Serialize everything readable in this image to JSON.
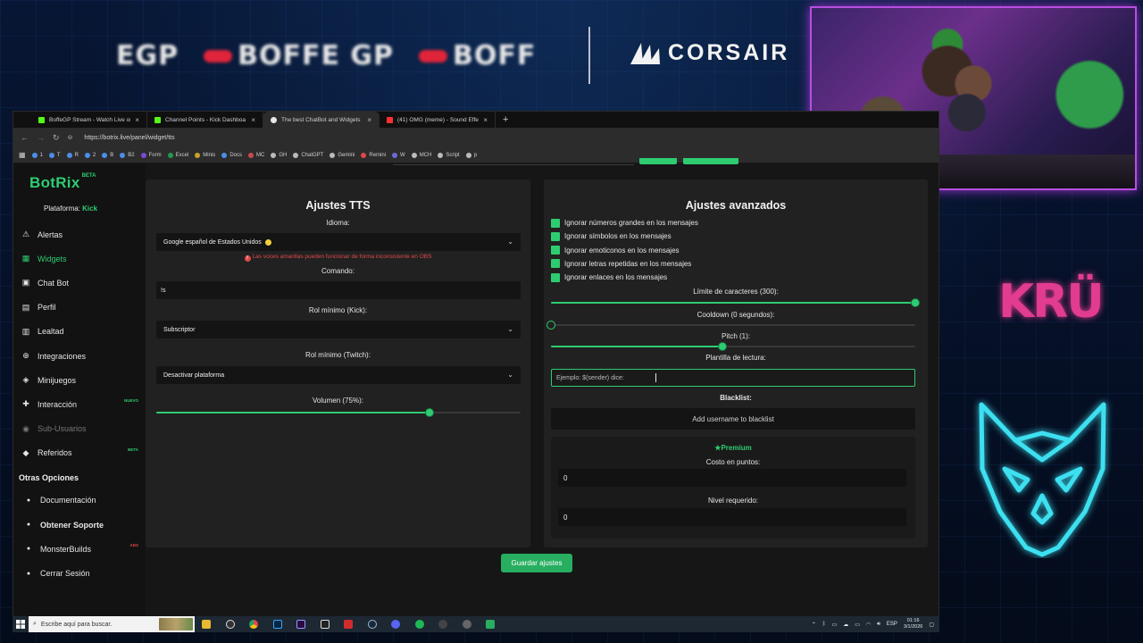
{
  "overlay": {
    "ticker": [
      "EGP",
      "BOFFE GP",
      "BOFF"
    ],
    "sponsor": "CORSAIR",
    "right_logo": "KRÜ"
  },
  "browser": {
    "tabs": [
      {
        "label": "BoffeGP Stream - Watch Live on",
        "color": "#53fc18"
      },
      {
        "label": "Channel Points - Kick Dashboa",
        "color": "#53fc18"
      },
      {
        "label": "The best ChatBot and Widgets",
        "color": "#e8e8e8"
      },
      {
        "label": "(41) OMG (meme) - Sound Effe",
        "color": "#ff3030"
      }
    ],
    "new_tab": "+",
    "url": "https://botrix.live/panel/widget/tts",
    "bookmarks": [
      {
        "label": "1",
        "color": "#4a8fe7"
      },
      {
        "label": "T",
        "color": "#4a8fe7"
      },
      {
        "label": "R",
        "color": "#4a8fe7"
      },
      {
        "label": "2",
        "color": "#4a8fe7"
      },
      {
        "label": "B",
        "color": "#4a8fe7"
      },
      {
        "label": "B2",
        "color": "#4a8fe7"
      },
      {
        "label": "Form",
        "color": "#7b4ad6"
      },
      {
        "label": "Excel",
        "color": "#1f9b4a"
      },
      {
        "label": "Minis",
        "color": "#c9a227"
      },
      {
        "label": "Docs",
        "color": "#4a8fe7"
      },
      {
        "label": "MC",
        "color": "#c94a4a"
      },
      {
        "label": "GH",
        "color": "#bbbbbb"
      },
      {
        "label": "ChatGPT",
        "color": "#bbbbbb"
      },
      {
        "label": "Gemini",
        "color": "#bbbbbb"
      },
      {
        "label": "Remini",
        "color": "#e04848"
      },
      {
        "label": "W",
        "color": "#6a6ad6"
      },
      {
        "label": "MCH",
        "color": "#bbbbbb"
      },
      {
        "label": "Script",
        "color": "#bbbbbb"
      },
      {
        "label": "p",
        "color": "#bbbbbb"
      }
    ]
  },
  "app": {
    "logo": "BotRix",
    "beta": "BETA",
    "platform_label": "Plataforma:",
    "platform_value": "Kick",
    "nav": [
      {
        "label": "Alertas",
        "icon": "⚠",
        "active": false,
        "disabled": false,
        "badge": ""
      },
      {
        "label": "Widgets",
        "icon": "▦",
        "active": true,
        "disabled": false,
        "badge": ""
      },
      {
        "label": "Chat Bot",
        "icon": "▣",
        "active": false,
        "disabled": false,
        "badge": ""
      },
      {
        "label": "Perfil",
        "icon": "▤",
        "active": false,
        "disabled": false,
        "badge": ""
      },
      {
        "label": "Lealtad",
        "icon": "▥",
        "active": false,
        "disabled": false,
        "badge": ""
      },
      {
        "label": "Integraciones",
        "icon": "⊕",
        "active": false,
        "disabled": false,
        "badge": ""
      },
      {
        "label": "Minijuegos",
        "icon": "◈",
        "active": false,
        "disabled": false,
        "badge": ""
      },
      {
        "label": "Interacción",
        "icon": "✚",
        "active": false,
        "disabled": false,
        "badge": "NUEVO"
      },
      {
        "label": "Sub-Usuarios",
        "icon": "◉",
        "active": false,
        "disabled": true,
        "badge": ""
      },
      {
        "label": "Referidos",
        "icon": "◆",
        "active": false,
        "disabled": false,
        "badge": "BETA"
      }
    ],
    "other_options_title": "Otras Opciones",
    "other_options": [
      {
        "label": "Documentación",
        "icon": "●",
        "badge": ""
      },
      {
        "label": "Obtener Soporte",
        "icon": "●",
        "badge": ""
      },
      {
        "label": "MonsterBuilds",
        "icon": "●",
        "badge": "ADS"
      },
      {
        "label": "Cerrar Sesión",
        "icon": "●",
        "badge": ""
      }
    ]
  },
  "tts": {
    "title": "Ajustes TTS",
    "idioma_label": "Idioma:",
    "idioma_value": "Google español de Estados Unidos",
    "warning": "Las voces amarillas pueden funcionar de forma inconsistente en OBS",
    "comando_label": "Comando:",
    "comando_value": "!s",
    "rol_kick_label": "Rol mínimo (Kick):",
    "rol_kick_value": "Subscriptor",
    "rol_twitch_label": "Rol mínimo (Twitch):",
    "rol_twitch_value": "Desactivar plataforma",
    "volumen_label": "Volumen (75%):",
    "volumen_value": 0.75
  },
  "advanced": {
    "title": "Ajustes avanzados",
    "checks": [
      "Ignorar números grandes en los mensajes",
      "Ignorar símbolos en los mensajes",
      "Ignorar emoticonos en los mensajes",
      "Ignorar letras repetidas en los mensajes",
      "Ignorar enlaces en los mensajes"
    ],
    "char_limit_label": "Límite de caracteres (300):",
    "char_limit_value": 1.0,
    "cooldown_label": "Cooldown (0 segundos):",
    "cooldown_value": 0.0,
    "pitch_label": "Pitch (1):",
    "pitch_value": 0.47,
    "template_label": "Plantilla de lectura:",
    "template_placeholder": "Ejemplo: $(sender) dice:",
    "blacklist_label": "Blacklist:",
    "blacklist_button": "Add username to blacklist",
    "premium_title": "Premium",
    "cost_label": "Costo en puntos:",
    "cost_value": "0",
    "level_label": "Nivel requerido:",
    "level_value": "0"
  },
  "save_button": "Guardar ajustes",
  "taskbar": {
    "search_placeholder": "Escribe aquí para buscar.",
    "lang": "ESP",
    "time": "01:16",
    "date": "3/1/2026"
  }
}
